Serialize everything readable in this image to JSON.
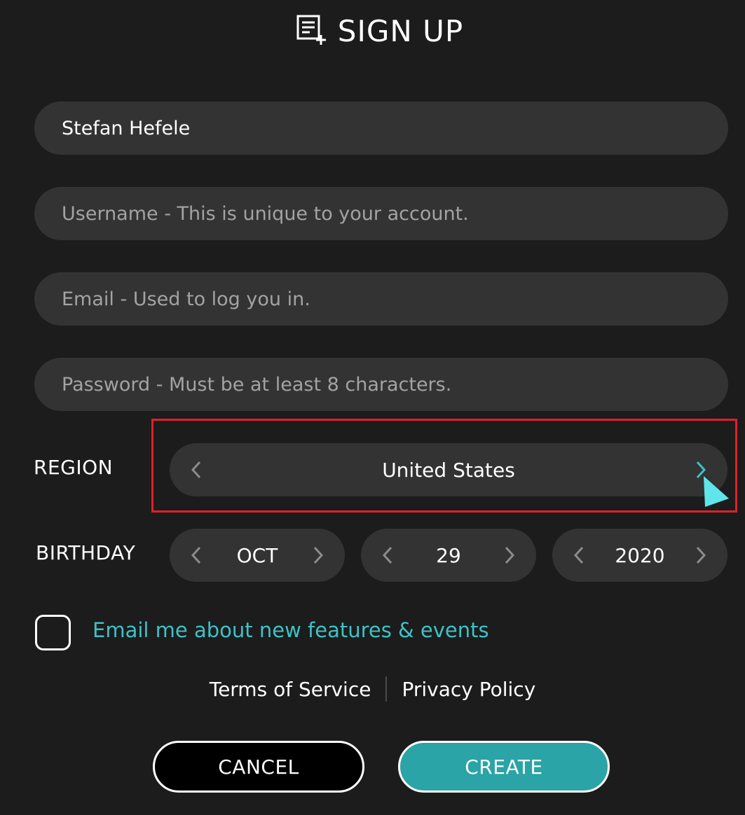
{
  "header": {
    "title": "SIGN UP",
    "icon": "form-add-icon"
  },
  "form": {
    "full_name": {
      "value": "Stefan Hefele",
      "placeholder": ""
    },
    "username": {
      "value": "",
      "placeholder": "Username - This is unique to your account."
    },
    "email": {
      "value": "",
      "placeholder": "Email - Used to log you in."
    },
    "password": {
      "value": "",
      "placeholder": "Password - Must be at least 8 characters."
    }
  },
  "region": {
    "label": "REGION",
    "value": "United States"
  },
  "birthday": {
    "label": "BIRTHDAY",
    "month": "OCT",
    "day": "29",
    "year": "2020"
  },
  "newsletter": {
    "label": "Email me about new features & events",
    "checked": false
  },
  "links": {
    "terms": "Terms of Service",
    "privacy": "Privacy Policy"
  },
  "buttons": {
    "cancel": "CANCEL",
    "create": "CREATE"
  },
  "colors": {
    "background": "#1c1c1c",
    "field": "#333333",
    "accent": "#2aa4a6",
    "link_accent": "#3ec2c6",
    "highlight": "#e0202a"
  }
}
